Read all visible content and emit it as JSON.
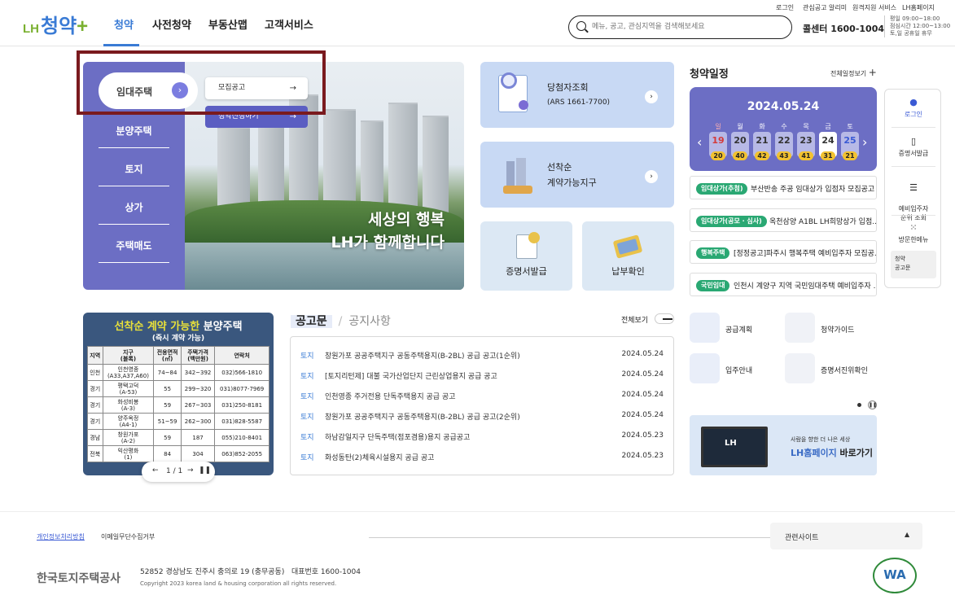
{
  "header": {
    "logo_lh": "LH",
    "logo_main": "청약",
    "logo_plus": "+",
    "nav": [
      "청약",
      "사전청약",
      "부동산맵",
      "고객서비스"
    ],
    "util": [
      "로그인",
      "관심공고 알리미",
      "원격지원 서비스",
      "LH홈페이지"
    ],
    "search_placeholder": "메뉴, 공고, 관심지역을 검색해보세요",
    "callcenter_label": "콜센터",
    "callcenter_number": "1600-1004",
    "hours": [
      "평일 09:00~18:00",
      "점심시간 12:00~13:00",
      "토,일 공휴일 휴무"
    ]
  },
  "left_menu": {
    "active": "임대주택",
    "items": [
      "분양주택",
      "토지",
      "상가",
      "주택매도"
    ],
    "sub": [
      "모집공고",
      "청약신청하기"
    ]
  },
  "hero": {
    "line1": "세상의 행복",
    "line2": "LH가 함께합니다"
  },
  "cards": {
    "winner_title": "당첨자조회",
    "winner_sub": "(ARS 1661-7700)",
    "first_come_title1": "선착순",
    "first_come_title2": "계약가능지구",
    "certificate": "증명서발급",
    "payment": "납부확인"
  },
  "schedule": {
    "title": "청약일정",
    "more": "전체일정보기",
    "date": "2024.05.24",
    "dows": [
      "일",
      "월",
      "화",
      "수",
      "목",
      "금",
      "토"
    ],
    "days": [
      {
        "d": "19",
        "c": "20"
      },
      {
        "d": "20",
        "c": "40"
      },
      {
        "d": "21",
        "c": "42"
      },
      {
        "d": "22",
        "c": "43"
      },
      {
        "d": "23",
        "c": "41"
      },
      {
        "d": "24",
        "c": "31"
      },
      {
        "d": "25",
        "c": "21"
      }
    ],
    "notices": [
      {
        "badge": "임대상가(추첨)",
        "text": "부산반송 주공 임대상가 입점자 모집공고"
      },
      {
        "badge": "임대상가(공모 · 심사)",
        "text": "옥천삼양 A1BL LH희망상가 입점..."
      },
      {
        "badge": "행복주택",
        "text": "[정정공고]파주시 행복주택 예비입주자 모집공..."
      },
      {
        "badge": "국민임대",
        "text": "인천시 계양구 지역 국민임대주택 예비입주자 ..."
      }
    ]
  },
  "quick": {
    "items": [
      "로그인",
      "증명서발급",
      "예비입주자\n순위 조회",
      "방문한메뉴",
      "청약\n공고문"
    ]
  },
  "banner": {
    "title_y": "선착순 계약 가능한",
    "title_w": " 분양주택",
    "sub": "(즉시 계약 가능)",
    "headers": [
      "지역",
      "지구\n(블록)",
      "전용면적\n(㎡)",
      "주택가격\n(백만원)",
      "연락처"
    ],
    "rows": [
      [
        "인천",
        "인천영종\n(A33,A37,A60)",
        "74~84",
        "342~392",
        "032)566-1810"
      ],
      [
        "경기",
        "평택고덕\n(A-53)",
        "55",
        "299~320",
        "031)8077-7969"
      ],
      [
        "경기",
        "화성비봉\n(A-3)",
        "59",
        "267~303",
        "031)250-8181"
      ],
      [
        "경기",
        "양주옥정\n(A4-1)",
        "51~59",
        "262~300",
        "031)828-5587"
      ],
      [
        "경남",
        "창원가포\n(A-2)",
        "59",
        "187",
        "055)210-8401"
      ],
      [
        "전북",
        "익산평화\n(1)",
        "84",
        "304",
        "063)852-2055"
      ]
    ],
    "pager": "1 / 1"
  },
  "board": {
    "tab_on": "공고문",
    "tab_off": "공지사항",
    "viewall": "전체보기",
    "rows": [
      {
        "cat": "토지",
        "title": "창원가포 공공주택지구 공동주택용지(B-2BL) 공급 공고(1순위)",
        "date": "2024.05.24"
      },
      {
        "cat": "토지",
        "title": "[토지리턴제] 대불 국가산업단지 근린상업용지 공급 공고",
        "date": "2024.05.24"
      },
      {
        "cat": "토지",
        "title": "인천영종 주거전용 단독주택용지 공급 공고",
        "date": "2024.05.24"
      },
      {
        "cat": "토지",
        "title": "창원가포 공공주택지구 공동주택용지(B-2BL) 공급 공고(2순위)",
        "date": "2024.05.24"
      },
      {
        "cat": "토지",
        "title": "하남감일지구 단독주택(점포겸용)용지 공급공고",
        "date": "2024.05.23"
      },
      {
        "cat": "토지",
        "title": "화성동탄(2)체육시설용지 공급 공고",
        "date": "2024.05.23"
      }
    ]
  },
  "quicklinks": [
    "공급계획",
    "청약가이드",
    "입주안내",
    "증명서진위확인"
  ],
  "ad": {
    "line1": "사람을 향한 더 나은 세상",
    "line2a": "LH홈페이지",
    "line2b": " 바로가기"
  },
  "footer": {
    "privacy": "개인정보처리방침",
    "email": "이메일무단수집거부",
    "related": "관련사이트",
    "company": "한국토지주택공사",
    "address": "52852 경상남도 진주시 충의로 19 (충무공동)",
    "phone": "대표번호 1600-1004",
    "copyright": "Copyright 2023 korea land & housing corporation all rights reserved.",
    "wa": "WA"
  }
}
